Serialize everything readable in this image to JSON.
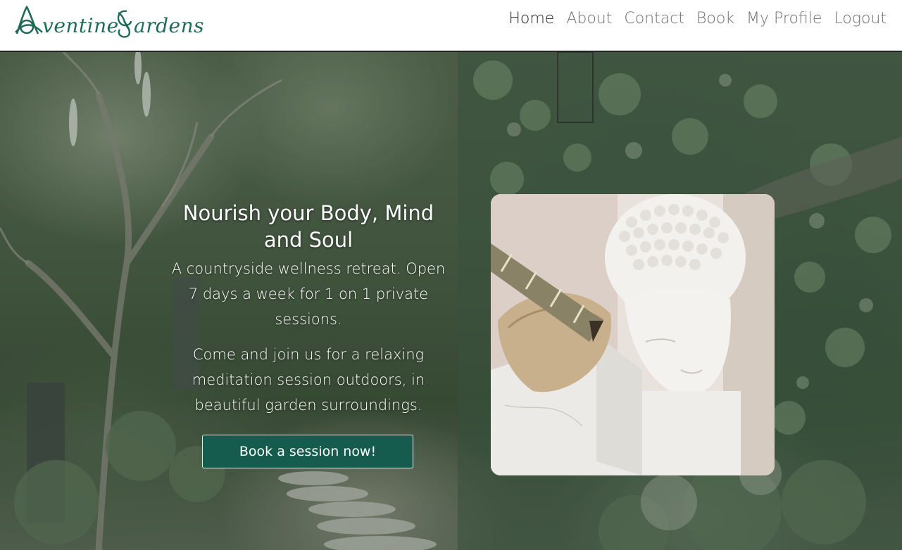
{
  "brand": {
    "logo_text": "Aventine Gardens",
    "logo_color": "#1f6b57"
  },
  "nav": {
    "items": [
      {
        "label": "Home",
        "active": true
      },
      {
        "label": "About",
        "active": false
      },
      {
        "label": "Contact",
        "active": false
      },
      {
        "label": "Book",
        "active": false
      },
      {
        "label": "My Profile",
        "active": false
      },
      {
        "label": "Logout",
        "active": false
      }
    ]
  },
  "hero": {
    "title": "Nourish your Body, Mind and Soul",
    "paragraph_1": "A countryside wellness retreat. Open 7 days a week for 1 on 1 private sessions.",
    "paragraph_2": "Come and join us for a relaxing meditation session outdoors, in beautiful garden surroundings.",
    "cta_label": "Book a session now!",
    "cta_color": "#165c4e",
    "image_subject": "white buddha head with sage smudge stick in shell",
    "background_subject": "garden path with trees, grasses and ivy"
  }
}
